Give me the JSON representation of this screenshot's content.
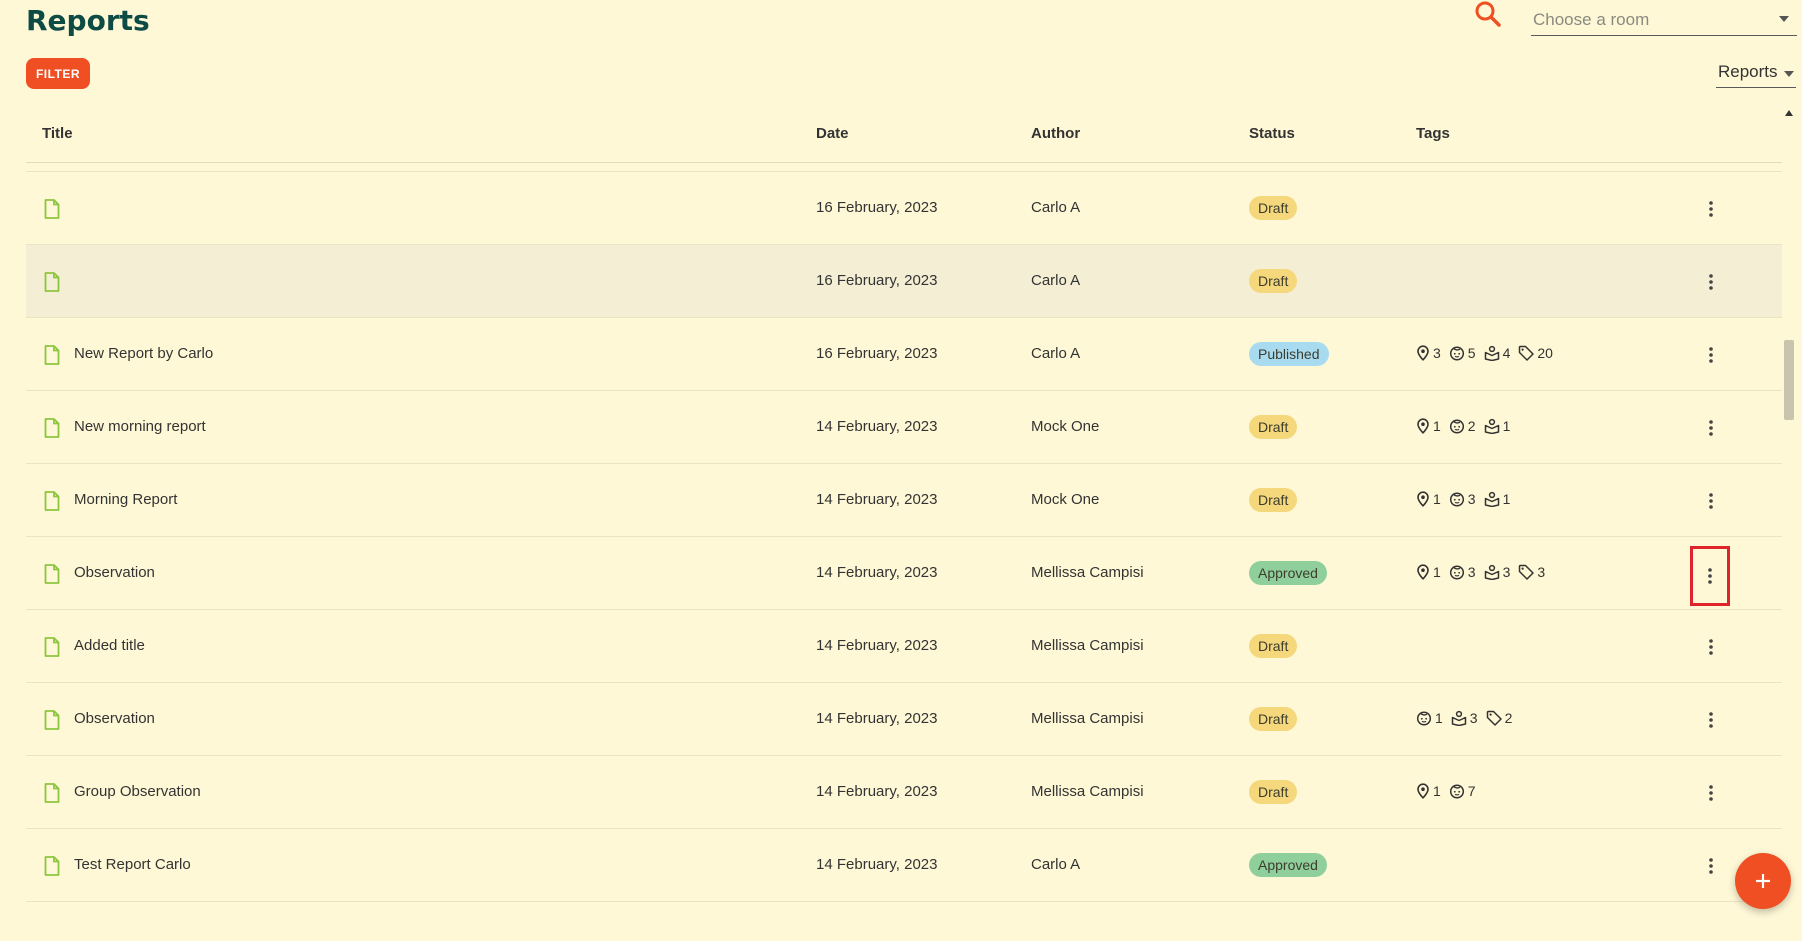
{
  "header": {
    "title": "Reports",
    "room_placeholder": "Choose a room",
    "filter_label": "FILTER",
    "view_label": "Reports"
  },
  "table": {
    "columns": [
      "Title",
      "Date",
      "Author",
      "Status",
      "Tags"
    ],
    "rows": [
      {
        "title": "",
        "date": "16 February, 2023",
        "author": "Carlo A",
        "status": "Draft",
        "status_kind": "draft",
        "tags": []
      },
      {
        "title": "",
        "date": "16 February, 2023",
        "author": "Carlo A",
        "status": "Draft",
        "status_kind": "draft",
        "tags": []
      },
      {
        "title": "",
        "date": "16 February, 2023",
        "author": "Carlo A",
        "status": "Draft",
        "status_kind": "draft",
        "tags": [],
        "highlighted": true
      },
      {
        "title": "New Report by Carlo",
        "date": "16 February, 2023",
        "author": "Carlo A",
        "status": "Published",
        "status_kind": "published",
        "tags": [
          {
            "icon": "location-pin-icon",
            "count": "3"
          },
          {
            "icon": "child-face-icon",
            "count": "5"
          },
          {
            "icon": "learning-area-icon",
            "count": "4"
          },
          {
            "icon": "tag-icon",
            "count": "20"
          }
        ]
      },
      {
        "title": "New morning report",
        "date": "14 February, 2023",
        "author": "Mock One",
        "status": "Draft",
        "status_kind": "draft",
        "tags": [
          {
            "icon": "location-pin-icon",
            "count": "1"
          },
          {
            "icon": "child-face-icon",
            "count": "2"
          },
          {
            "icon": "learning-area-icon",
            "count": "1"
          }
        ]
      },
      {
        "title": "Morning Report",
        "date": "14 February, 2023",
        "author": "Mock One",
        "status": "Draft",
        "status_kind": "draft",
        "tags": [
          {
            "icon": "location-pin-icon",
            "count": "1"
          },
          {
            "icon": "child-face-icon",
            "count": "3"
          },
          {
            "icon": "learning-area-icon",
            "count": "1"
          }
        ]
      },
      {
        "title": "Observation",
        "date": "14 February, 2023",
        "author": "Mellissa Campisi",
        "status": "Approved",
        "status_kind": "approved",
        "selected_menu": true,
        "tags": [
          {
            "icon": "location-pin-icon",
            "count": "1"
          },
          {
            "icon": "child-face-icon",
            "count": "3"
          },
          {
            "icon": "learning-area-icon",
            "count": "3"
          },
          {
            "icon": "tag-icon",
            "count": "3"
          }
        ]
      },
      {
        "title": "Added title",
        "date": "14 February, 2023",
        "author": "Mellissa Campisi",
        "status": "Draft",
        "status_kind": "draft",
        "tags": []
      },
      {
        "title": "Observation",
        "date": "14 February, 2023",
        "author": "Mellissa Campisi",
        "status": "Draft",
        "status_kind": "draft",
        "tags": [
          {
            "icon": "child-face-icon",
            "count": "1"
          },
          {
            "icon": "learning-area-icon",
            "count": "3"
          },
          {
            "icon": "tag-icon",
            "count": "2"
          }
        ]
      },
      {
        "title": "Group Observation",
        "date": "14 February, 2023",
        "author": "Mellissa Campisi",
        "status": "Draft",
        "status_kind": "draft",
        "tags": [
          {
            "icon": "location-pin-icon",
            "count": "1"
          },
          {
            "icon": "child-face-icon",
            "count": "7"
          }
        ]
      },
      {
        "title": "Test Report Carlo",
        "date": "14 February, 2023",
        "author": "Carlo A",
        "status": "Approved",
        "status_kind": "approved",
        "tags": []
      }
    ]
  },
  "colors": {
    "background": "#fff8d6",
    "accent": "#ef4f22",
    "title": "#0e4b45",
    "doc_icon": "#8cc63f"
  }
}
